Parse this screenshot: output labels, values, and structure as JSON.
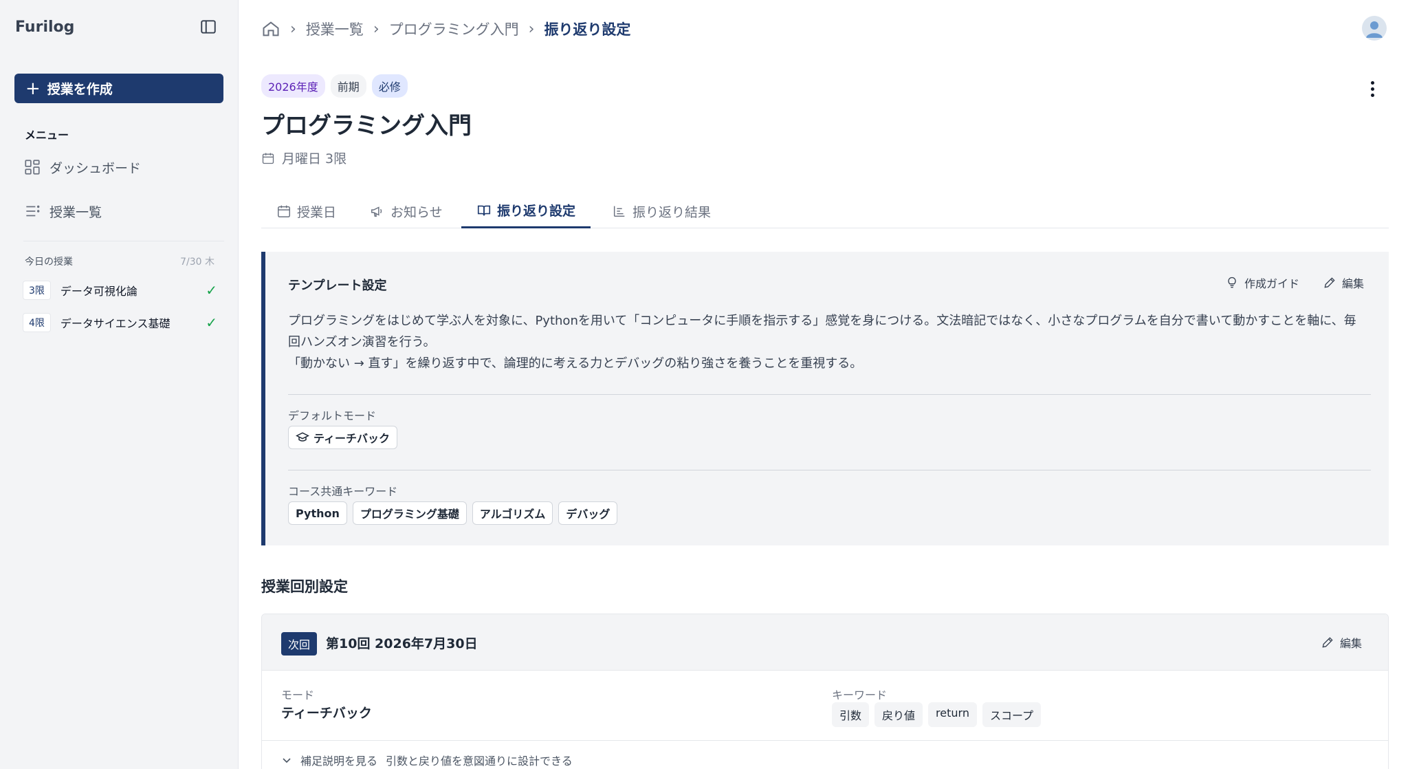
{
  "sidebar": {
    "brand": "Furilog",
    "create_button": "授業を作成",
    "menu_heading": "メニュー",
    "nav": [
      {
        "label": "ダッシュボード",
        "icon": "dashboard-icon"
      },
      {
        "label": "授業一覧",
        "icon": "list-icon"
      }
    ],
    "today": {
      "heading": "今日の授業",
      "date": "7/30 木",
      "items": [
        {
          "period": "3限",
          "title": "データ可視化論",
          "done": true
        },
        {
          "period": "4限",
          "title": "データサイエンス基礎",
          "done": true
        }
      ]
    }
  },
  "breadcrumb": {
    "items": [
      "授業一覧",
      "プログラミング入門"
    ],
    "current": "振り返り設定"
  },
  "course": {
    "tags": [
      "2026年度",
      "前期",
      "必修"
    ],
    "title": "プログラミング入門",
    "schedule": "月曜日 3限"
  },
  "tabs": [
    {
      "label": "授業日",
      "icon": "calendar-icon"
    },
    {
      "label": "お知らせ",
      "icon": "megaphone-icon"
    },
    {
      "label": "振り返り設定",
      "icon": "book-icon",
      "active": true
    },
    {
      "label": "振り返り結果",
      "icon": "chart-icon"
    }
  ],
  "template": {
    "title": "テンプレート設定",
    "guide_label": "作成ガイド",
    "edit_label": "編集",
    "description_line1": "プログラミングをはじめて学ぶ人を対象に、Pythonを用いて「コンピュータに手順を指示する」感覚を身につける。文法暗記ではなく、小さなプログラムを自分で書いて動かすことを軸に、毎回ハンズオン演習を行う。",
    "description_line2": "「動かない → 直す」を繰り返す中で、論理的に考える力とデバッグの粘り強さを養うことを重視する。",
    "default_mode_label": "デフォルトモード",
    "default_mode": "ティーチバック",
    "keywords_label": "コース共通キーワード",
    "keywords": [
      "Python",
      "プログラミング基礎",
      "アルゴリズム",
      "デバッグ"
    ]
  },
  "sessions": {
    "section_title": "授業回別設定",
    "next_badge": "次回",
    "title": "第10回  2026年7月30日",
    "edit_label": "編集",
    "mode_label": "モード",
    "mode": "ティーチバック",
    "keywords_label": "キーワード",
    "keywords": [
      "引数",
      "戻り値",
      "return",
      "スコープ"
    ],
    "expand_label": "補足説明を見る",
    "expand_summary": "引数と戻り値を意図通りに設計できる"
  },
  "colors": {
    "accent": "#1e3a6e",
    "check": "#16a34a"
  }
}
